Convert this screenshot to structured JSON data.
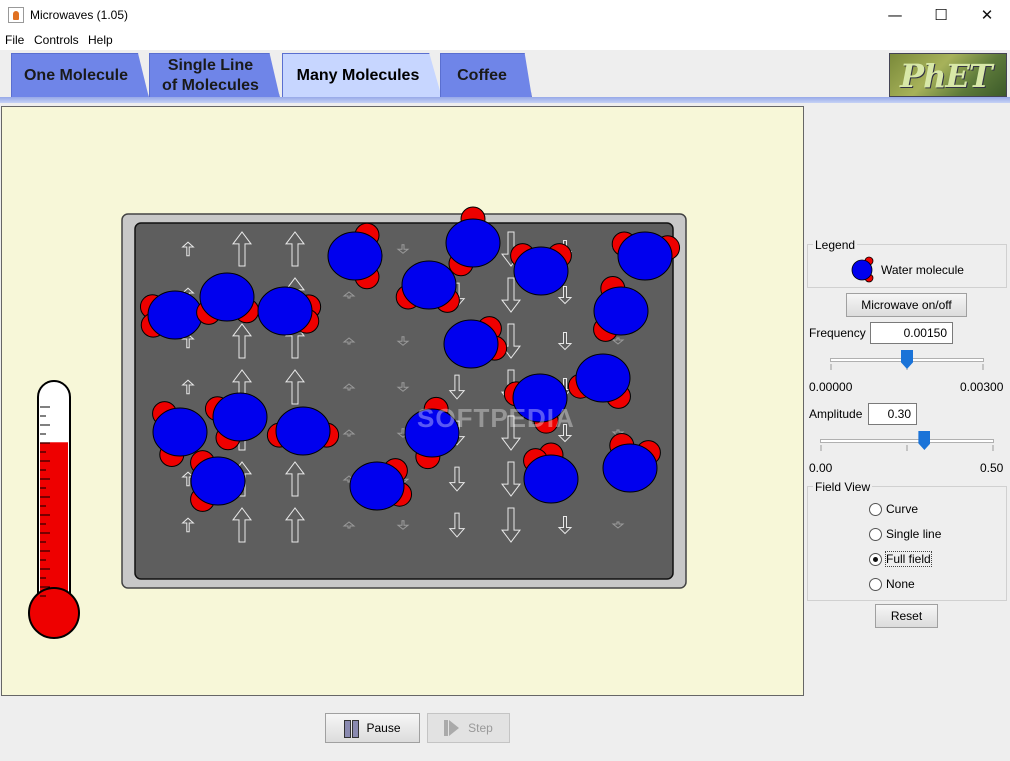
{
  "window": {
    "title": "Microwaves (1.05)",
    "minimize_glyph": "—",
    "maximize_glyph": "☐",
    "close_glyph": "✕"
  },
  "menu": [
    "File",
    "Controls",
    "Help"
  ],
  "tabs": [
    {
      "label": "One Molecule",
      "active": false
    },
    {
      "label": "Single Line of Molecules",
      "line1": "Single Line",
      "line2": "of Molecules",
      "active": false
    },
    {
      "label": "Many Molecules",
      "active": true
    },
    {
      "label": "Coffee",
      "active": false
    }
  ],
  "logo": {
    "text": "PhET"
  },
  "watermark": "SOFTPEDIA",
  "legend": {
    "title": "Legend",
    "item_label": "Water molecule"
  },
  "controls": {
    "microwave_button": "Microwave on/off",
    "frequency": {
      "label": "Frequency",
      "value": "0.00150",
      "min_label": "0.00000",
      "max_label": "0.00300",
      "level": 0.5
    },
    "amplitude": {
      "label": "Amplitude",
      "value": "0.30",
      "min_label": "0.00",
      "max_label": "0.50",
      "level": 0.6
    },
    "field_view": {
      "title": "Field View",
      "options": [
        {
          "label": "Curve",
          "selected": false
        },
        {
          "label": "Single line",
          "selected": false
        },
        {
          "label": "Full field",
          "selected": true
        },
        {
          "label": "None",
          "selected": false
        }
      ]
    },
    "reset_button": "Reset"
  },
  "playback": {
    "pause_label": "Pause",
    "step_label": "Step",
    "step_enabled": false
  },
  "thermometer": {
    "level": 0.78
  },
  "colors": {
    "canvas_bg": "#f7f7d8",
    "oven": "#5e5e5e",
    "oxygen": "#0000ee",
    "hydrogen": "#ee0000",
    "mercury": "#ee0000",
    "tab": "#6f85e8",
    "tab_active": "#c7d6ff",
    "slider_thumb": "#1a73d8"
  }
}
